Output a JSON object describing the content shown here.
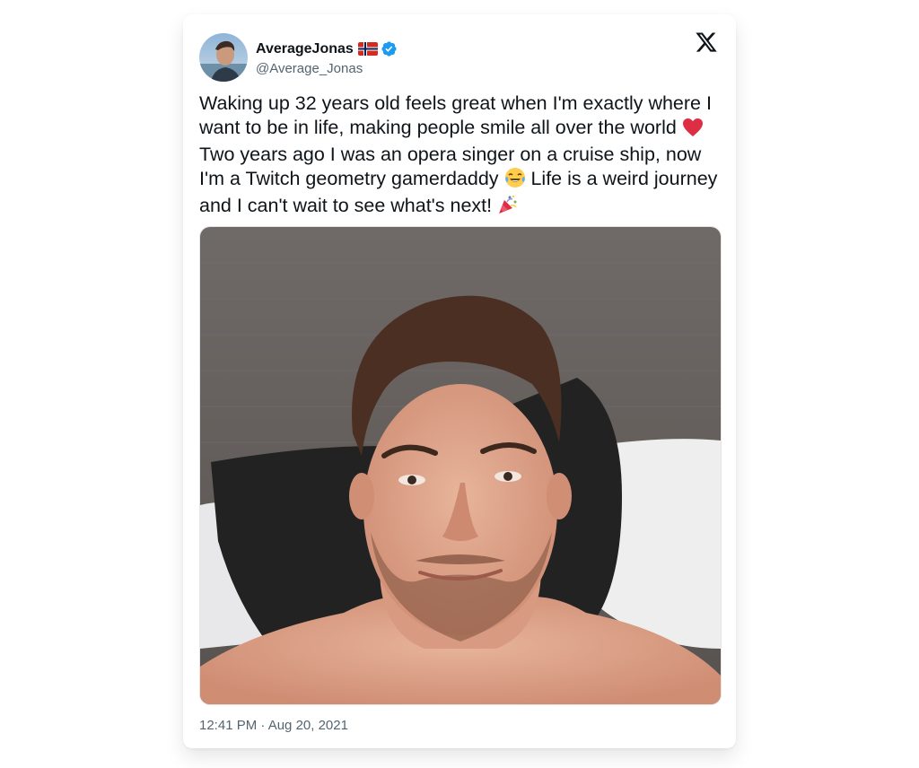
{
  "author": {
    "display_name": "AverageJonas",
    "handle": "@Average_Jonas",
    "flag_icon": "norway-flag-icon",
    "verified_icon": "verified-badge-icon",
    "avatar": "profile-avatar"
  },
  "brand": {
    "logo_icon": "x-logo-icon"
  },
  "tweet": {
    "text_parts": [
      "Waking up 32 years old feels great when I'm exactly where I want to be in life, making people smile all over the world ",
      " Two years ago I was an opera singer on a cruise ship, now I'm a Twitch geometry gamerdaddy ",
      " Life is a weird journey and I can't wait to see what's next! "
    ],
    "emojis": [
      "red-heart-icon",
      "tears-of-joy-icon",
      "party-popper-icon"
    ],
    "timestamp": "12:41 PM · Aug 20, 2021"
  },
  "media": {
    "type": "photo",
    "subject": "selfie-photo"
  },
  "colors": {
    "text": "#0f1419",
    "secondary": "#536471",
    "verified": "#1d9bf0",
    "heart": "#e0245e"
  }
}
